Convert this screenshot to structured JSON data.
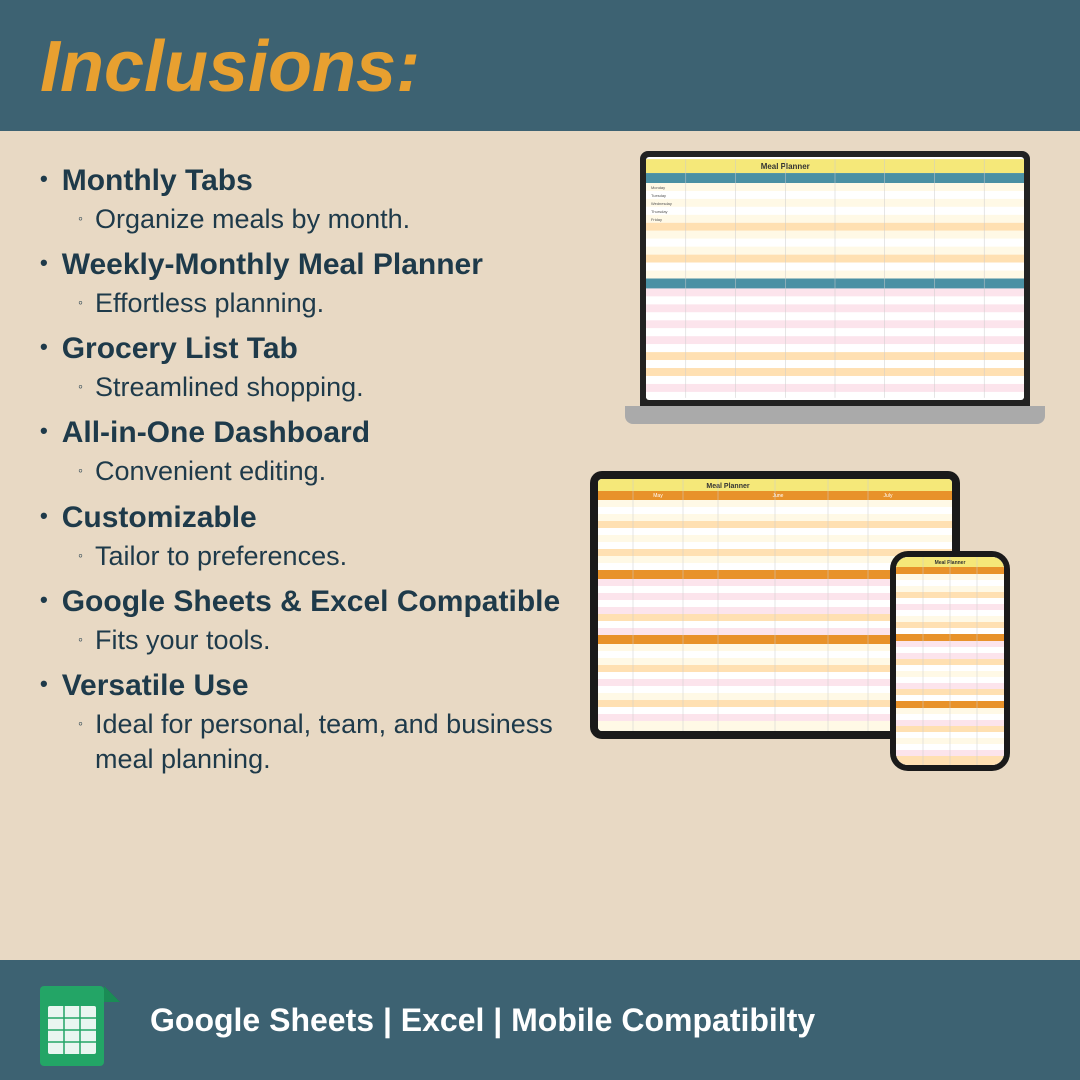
{
  "header": {
    "title": "Inclusions:"
  },
  "bullets": [
    {
      "main": "Monthly Tabs",
      "sub": "Organize meals by month."
    },
    {
      "main": "Weekly-Monthly Meal Planner",
      "sub": "Effortless planning."
    },
    {
      "main": "Grocery List Tab",
      "sub": "Streamlined shopping."
    },
    {
      "main": "All-in-One Dashboard",
      "sub": "Convenient editing."
    },
    {
      "main": "Customizable",
      "sub": "Tailor to preferences."
    },
    {
      "main": "Google Sheets & Excel Compatible",
      "sub": "Fits your tools."
    },
    {
      "main": "Versatile Use",
      "sub": "Ideal for personal, team, and business meal planning."
    }
  ],
  "footer": {
    "text": "Google Sheets | Excel | Mobile Compatibilty"
  },
  "colors": {
    "header_bg": "#3d6272",
    "title_color": "#e8a030",
    "body_bg": "#e8d9c4",
    "text_color": "#1e3a4a"
  }
}
